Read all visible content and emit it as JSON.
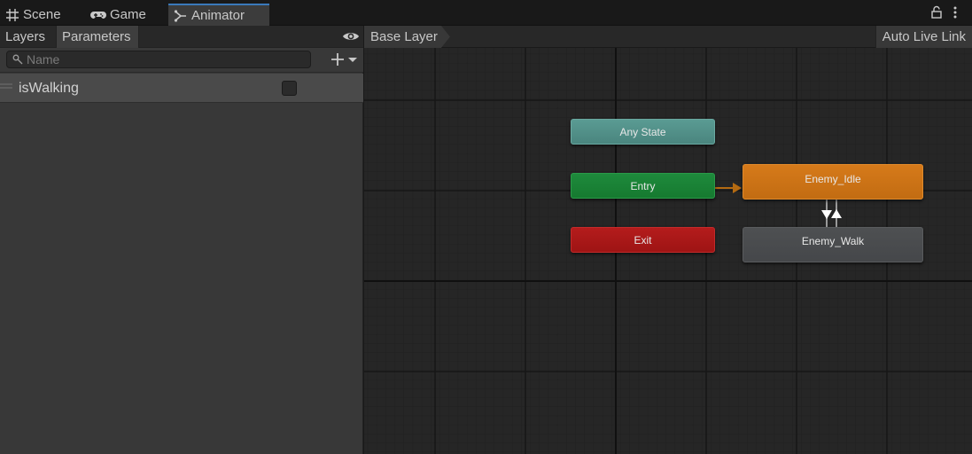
{
  "window_tabs": [
    {
      "label": "Scene",
      "icon": "grid-icon"
    },
    {
      "label": "Game",
      "icon": "gamepad-icon"
    },
    {
      "label": "Animator",
      "icon": "animator-icon",
      "active": true
    }
  ],
  "left_panel": {
    "tabs": [
      {
        "label": "Layers"
      },
      {
        "label": "Parameters",
        "active": true
      }
    ],
    "search_placeholder": "Name",
    "parameters": [
      {
        "name": "isWalking",
        "type": "bool",
        "value": false
      }
    ]
  },
  "graph": {
    "breadcrumb": "Base Layer",
    "auto_live_link": "Auto Live Link",
    "states": {
      "any_state": "Any State",
      "entry": "Entry",
      "exit": "Exit",
      "enemy_idle": "Enemy_Idle",
      "enemy_walk": "Enemy_Walk"
    }
  },
  "colors": {
    "any_state": "#4f8f88",
    "entry": "#1a8236",
    "exit": "#a81818",
    "default_state": "#cc7316",
    "state": "#4a4c4e",
    "transition_default": "#b36a12",
    "transition": "#d8d8d8",
    "accent_tab": "#3a79bb"
  }
}
